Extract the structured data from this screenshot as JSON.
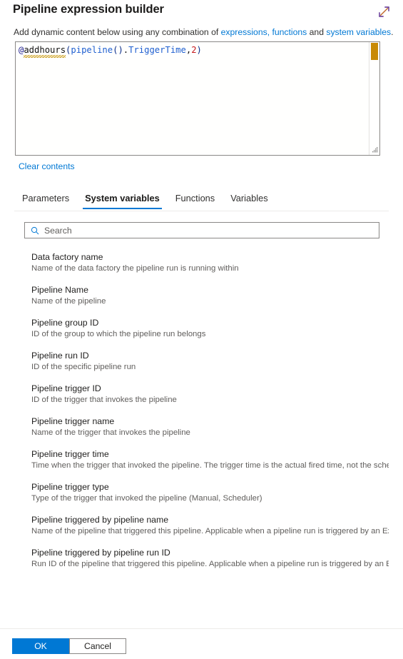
{
  "header": {
    "title": "Pipeline expression builder",
    "expand_icon": "expand-diagonal-icon",
    "subtitle": {
      "prefix": "Add dynamic content below using any combination of ",
      "link1": "expressions, functions",
      "middle": " and ",
      "link2": "system variables",
      "suffix": "."
    }
  },
  "editor": {
    "expression": "@addhours(pipeline().TriggerTime,2)",
    "tokens": {
      "at": "@",
      "func": "addhours",
      "open1": "(",
      "builtin": "pipeline",
      "open2": "(",
      "close2": ")",
      "dot": ".",
      "prop": "TriggerTime",
      "comma": ",",
      "num": "2",
      "close1": ")"
    },
    "error_marker": "error-annotation-marker",
    "resize_grip": "resize-grip-icon",
    "clear_link": "Clear contents"
  },
  "tabs": [
    {
      "label": "Parameters",
      "active": false
    },
    {
      "label": "System variables",
      "active": true
    },
    {
      "label": "Functions",
      "active": false
    },
    {
      "label": "Variables",
      "active": false
    }
  ],
  "search": {
    "placeholder": "Search",
    "value": "",
    "icon": "search-icon"
  },
  "variables": [
    {
      "name": "Data factory name",
      "description": "Name of the data factory the pipeline run is running within"
    },
    {
      "name": "Pipeline Name",
      "description": "Name of the pipeline"
    },
    {
      "name": "Pipeline group ID",
      "description": "ID of the group to which the pipeline run belongs"
    },
    {
      "name": "Pipeline run ID",
      "description": "ID of the specific pipeline run"
    },
    {
      "name": "Pipeline trigger ID",
      "description": "ID of the trigger that invokes the pipeline"
    },
    {
      "name": "Pipeline trigger name",
      "description": "Name of the trigger that invokes the pipeline"
    },
    {
      "name": "Pipeline trigger time",
      "description": "Time when the trigger that invoked the pipeline. The trigger time is the actual fired time, not the sched…"
    },
    {
      "name": "Pipeline trigger type",
      "description": "Type of the trigger that invoked the pipeline (Manual, Scheduler)"
    },
    {
      "name": "Pipeline triggered by pipeline name",
      "description": "Name of the pipeline that triggered this pipeline. Applicable when a pipeline run is triggered by an Exe…"
    },
    {
      "name": "Pipeline triggered by pipeline run ID",
      "description": "Run ID of the pipeline that triggered this pipeline. Applicable when a pipeline run is triggered by an Ex…"
    }
  ],
  "footer": {
    "ok_label": "OK",
    "cancel_label": "Cancel"
  },
  "colors": {
    "accent": "#0078d4",
    "link": "#0078d4",
    "error_marker": "#c88a06",
    "token_number": "#c5191d",
    "token_builtin": "#1f5fd0"
  }
}
